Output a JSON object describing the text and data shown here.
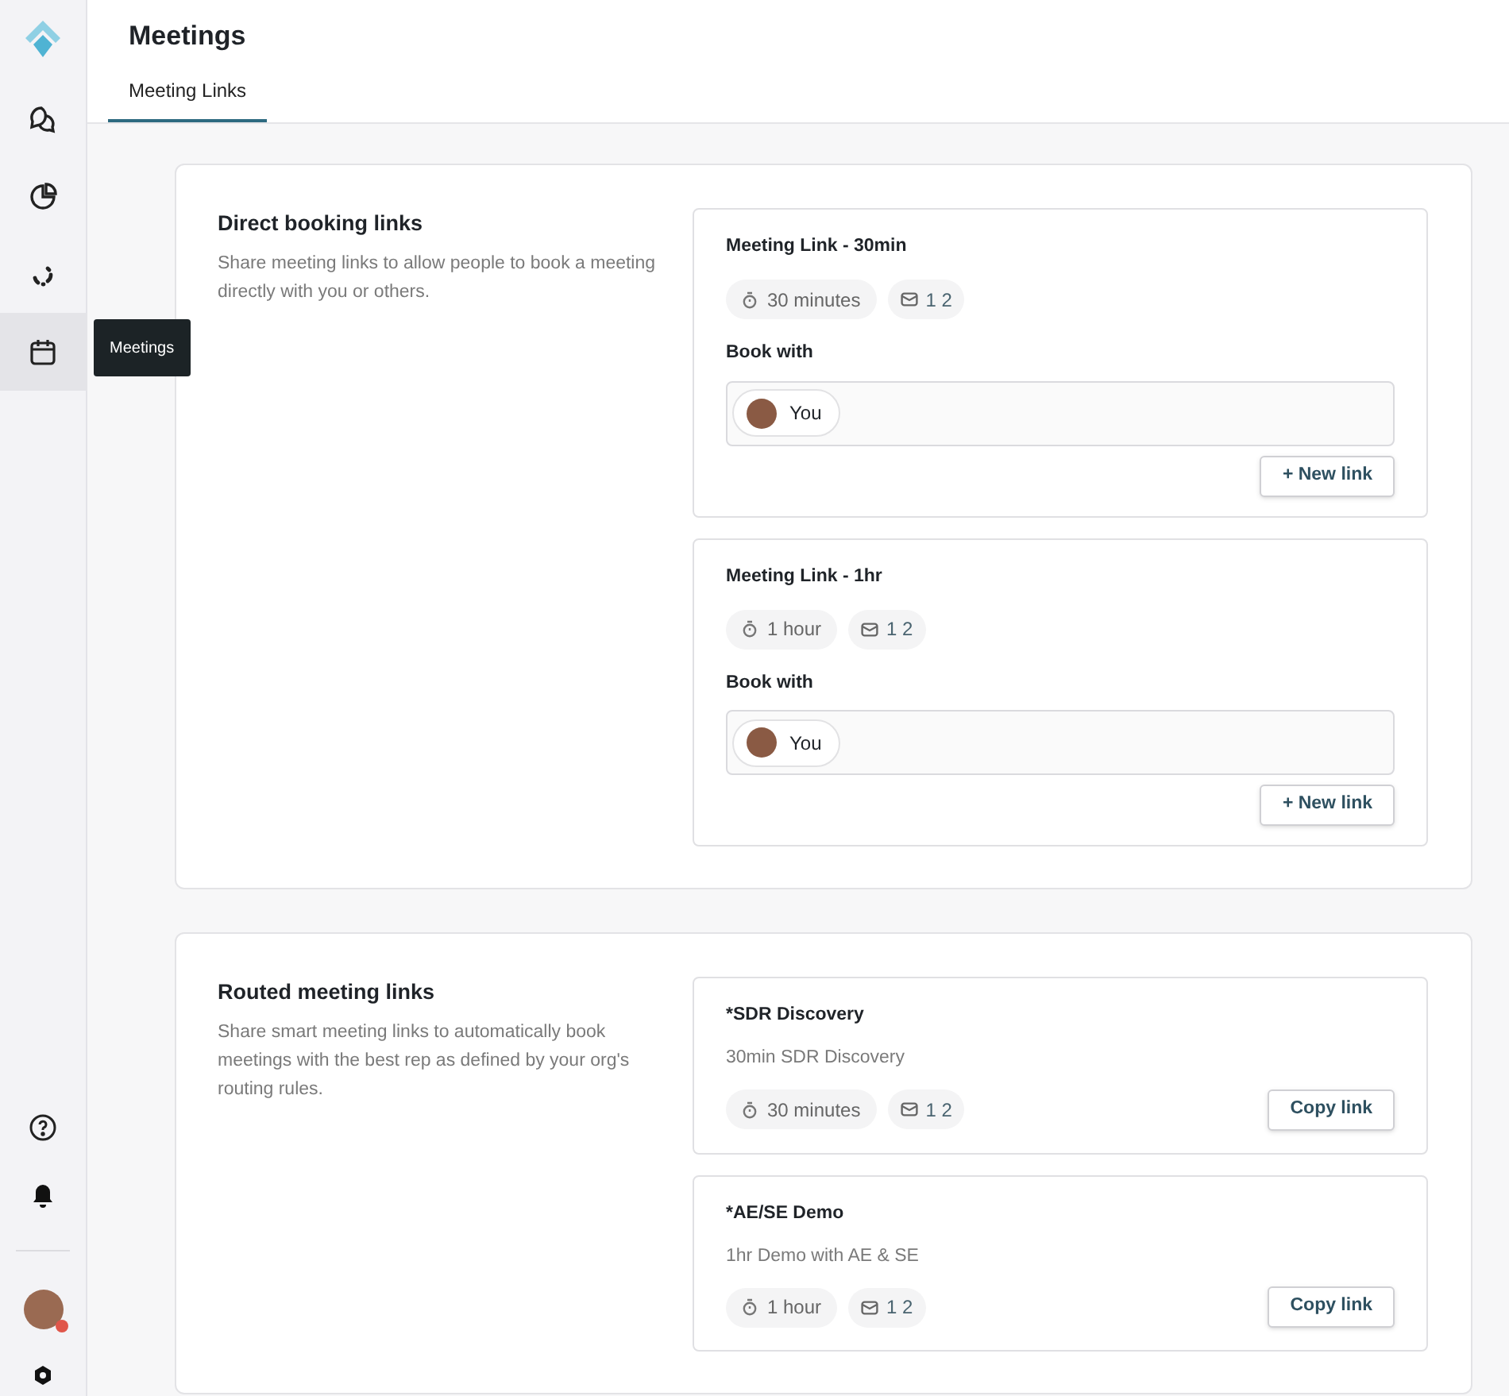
{
  "sidebar": {
    "nav_items": [
      {
        "selected": false
      },
      {
        "selected": false
      },
      {
        "selected": false
      },
      {
        "selected": true
      }
    ],
    "tooltip": "Meetings",
    "user": {
      "notification": true
    }
  },
  "header": {
    "title": "Meetings",
    "tabs": [
      {
        "label": "Meeting Links",
        "selected": true
      }
    ]
  },
  "sections": [
    {
      "title": "Direct booking links",
      "description": "Share meeting links to allow people to book a meeting directly with you or others.",
      "cards": [
        {
          "kind": "direct",
          "title": "Meeting Link - 30min",
          "duration": "30 minutes",
          "count": "1 2",
          "book_with_label": "Book with",
          "people": [
            "You"
          ],
          "button": "+ New link"
        },
        {
          "kind": "direct",
          "title": "Meeting Link - 1hr",
          "duration": "1 hour",
          "count": "1 2",
          "book_with_label": "Book with",
          "people": [
            "You"
          ],
          "button": "+ New link"
        }
      ]
    },
    {
      "title": "Routed meeting links",
      "description": "Share smart meeting links to automatically book meetings with the best rep as defined by your org's routing rules.",
      "cards": [
        {
          "kind": "routed",
          "title": "*SDR Discovery",
          "subtitle": "30min SDR Discovery",
          "duration": "30 minutes",
          "count": "1 2",
          "button": "Copy link"
        },
        {
          "kind": "routed",
          "title": "*AE/SE Demo",
          "subtitle": "1hr Demo with AE & SE",
          "duration": "1 hour",
          "count": "1 2",
          "button": "Copy link"
        }
      ]
    }
  ]
}
